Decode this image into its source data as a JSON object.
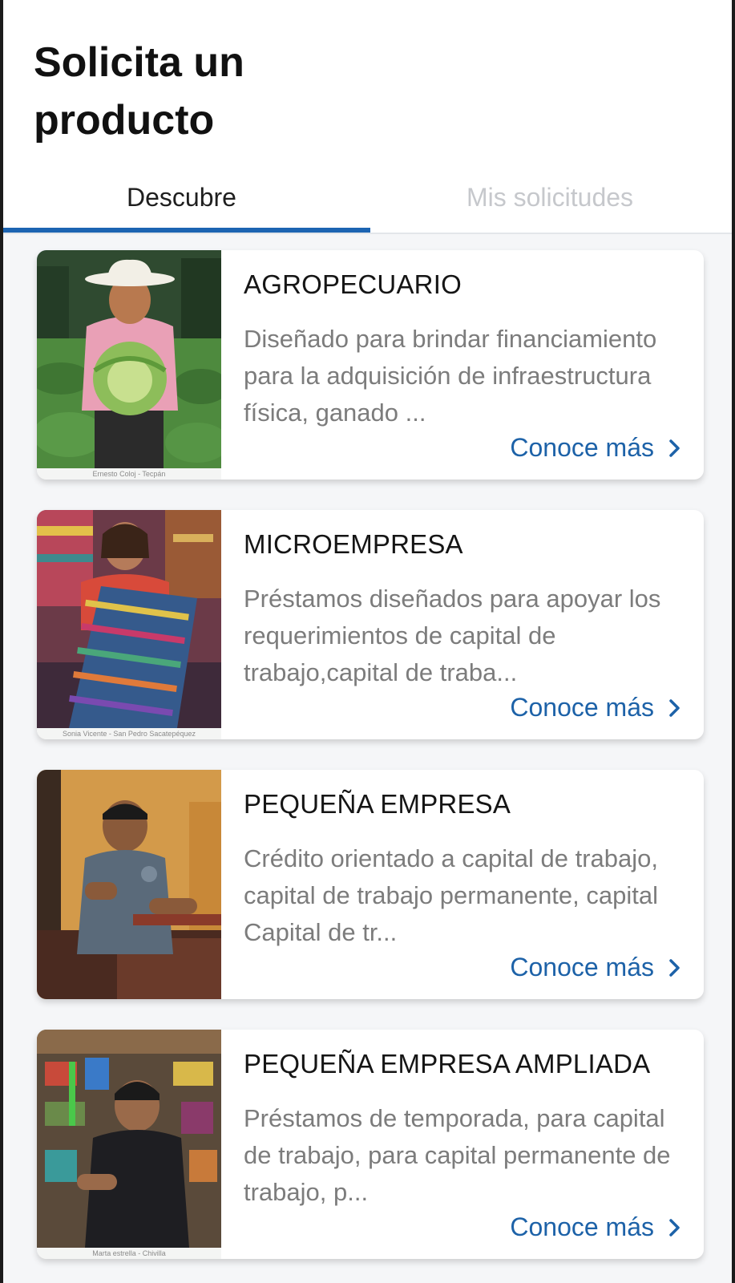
{
  "page": {
    "title": "Solicita un producto"
  },
  "tabs": [
    {
      "label": "Descubre",
      "active": true
    },
    {
      "label": "Mis solicitudes",
      "active": false
    }
  ],
  "colors": {
    "accent": "#1c64b2",
    "link": "#1d62a8",
    "inactive_tab": "#c6c8cc",
    "background": "#f5f6f8"
  },
  "products": [
    {
      "title": "AGROPECUARIO",
      "description": "Diseñado para brindar financiamiento para la adquisición de infraestructura física, ganado ...",
      "cta": "Conoce más",
      "image_caption": "Ernesto Coloj - Tecpán",
      "icon": "chevron-right-icon"
    },
    {
      "title": "MICROEMPRESA",
      "description": "Préstamos diseñados para apoyar los requerimientos de capital de trabajo,capital de traba...",
      "cta": "Conoce más",
      "image_caption": "Sonia Vicente - San Pedro Sacatepéquez",
      "icon": "chevron-right-icon"
    },
    {
      "title": "PEQUEÑA EMPRESA",
      "description": "Crédito orientado a capital de trabajo, capital de trabajo permanente, capital Capital de tr...",
      "cta": "Conoce más",
      "image_caption": "",
      "icon": "chevron-right-icon"
    },
    {
      "title": "PEQUEÑA EMPRESA AMPLIADA",
      "description": "Préstamos de temporada, para capital de trabajo, para capital permanente de trabajo, p...",
      "cta": "Conoce más",
      "image_caption": "Marta estrella - Chivilla",
      "icon": "chevron-right-icon"
    }
  ]
}
